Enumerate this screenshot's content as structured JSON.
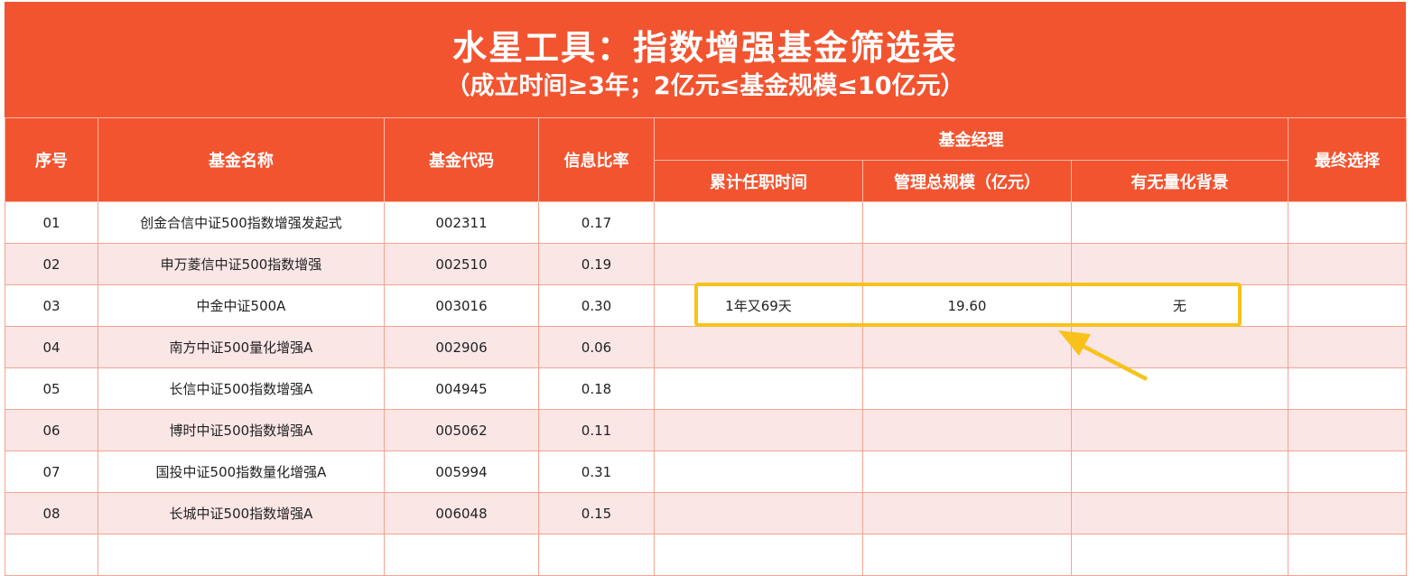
{
  "title": {
    "main": "水星工具：指数增强基金筛选表",
    "sub": "（成立时间≥3年；2亿元≤基金规模≤10亿元）"
  },
  "headers": {
    "index": "序号",
    "name": "基金名称",
    "code": "基金代码",
    "info_ratio": "信息比率",
    "manager_group": "基金经理",
    "tenure": "累计任职时间",
    "aum": "管理总规模（亿元）",
    "quant": "有无量化背景",
    "final": "最终选择"
  },
  "rows": [
    {
      "index": "01",
      "name": "创金合信中证500指数增强发起式",
      "code": "002311",
      "info_ratio": "0.17",
      "tenure": "",
      "aum": "",
      "quant": "",
      "final": ""
    },
    {
      "index": "02",
      "name": "申万菱信中证500指数增强",
      "code": "002510",
      "info_ratio": "0.19",
      "tenure": "",
      "aum": "",
      "quant": "",
      "final": ""
    },
    {
      "index": "03",
      "name": "中金中证500A",
      "code": "003016",
      "info_ratio": "0.30",
      "tenure": "1年又69天",
      "aum": "19.60",
      "quant": "无",
      "final": ""
    },
    {
      "index": "04",
      "name": "南方中证500量化增强A",
      "code": "002906",
      "info_ratio": "0.06",
      "tenure": "",
      "aum": "",
      "quant": "",
      "final": ""
    },
    {
      "index": "05",
      "name": "长信中证500指数增强A",
      "code": "004945",
      "info_ratio": "0.18",
      "tenure": "",
      "aum": "",
      "quant": "",
      "final": ""
    },
    {
      "index": "06",
      "name": "博时中证500指数增强A",
      "code": "005062",
      "info_ratio": "0.11",
      "tenure": "",
      "aum": "",
      "quant": "",
      "final": ""
    },
    {
      "index": "07",
      "name": "国投中证500指数量化增强A",
      "code": "005994",
      "info_ratio": "0.31",
      "tenure": "",
      "aum": "",
      "quant": "",
      "final": ""
    },
    {
      "index": "08",
      "name": "长城中证500指数增强A",
      "code": "006048",
      "info_ratio": "0.15",
      "tenure": "",
      "aum": "",
      "quant": "",
      "final": ""
    },
    {
      "index": "",
      "name": "",
      "code": "",
      "info_ratio": "",
      "tenure": "",
      "aum": "",
      "quant": "",
      "final": ""
    }
  ],
  "colors": {
    "header_bg": "#F25430",
    "stripe_bg": "#FBE6E6",
    "grid_line": "#F5A38F",
    "highlight": "#F8C21A"
  }
}
